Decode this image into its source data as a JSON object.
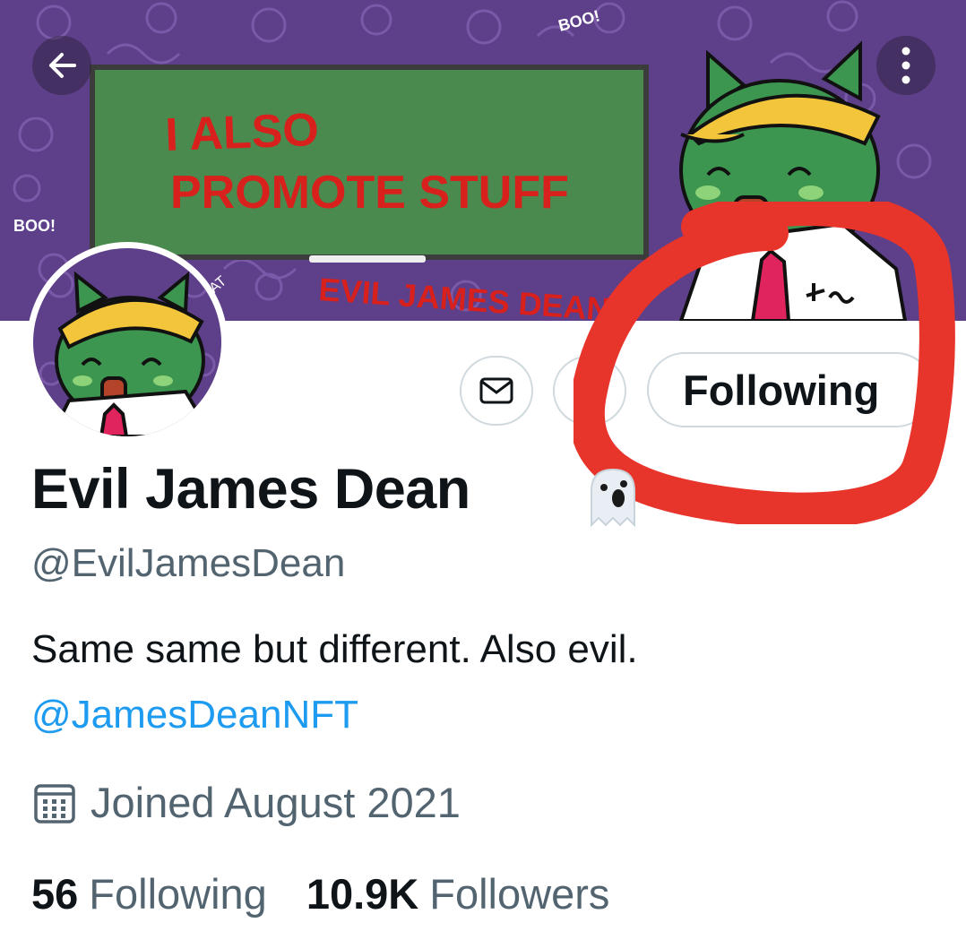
{
  "header": {
    "back_icon": "arrow-left-icon",
    "more_icon": "more-vertical-icon"
  },
  "banner": {
    "board_text_line1": "I ALSO",
    "board_text_line2": "PROMOTE STUFF",
    "signature": "EVIL JAMES DEAN",
    "doodle_boo": "BOO!",
    "doodle_cat": "CAT"
  },
  "actions": {
    "mail_icon": "envelope-icon",
    "bell_icon": "bell-icon",
    "following_label": "Following"
  },
  "profile": {
    "display_name": "Evil James Dean",
    "name_emoji": "ghost-emoji",
    "handle": "@EvilJamesDean",
    "bio": "Same same but different. Also evil.",
    "bio_link": "@JamesDeanNFT",
    "joined": "Joined August 2021",
    "joined_icon": "calendar-icon"
  },
  "stats": {
    "following_count": "56",
    "following_label": "Following",
    "followers_count": "10.9K",
    "followers_label": "Followers"
  },
  "colors": {
    "banner_purple": "#5d3f8a",
    "board_green": "#4a8a4e",
    "annotation_red": "#e8352c",
    "link_blue": "#1d9bf0",
    "secondary_text": "#536471"
  }
}
